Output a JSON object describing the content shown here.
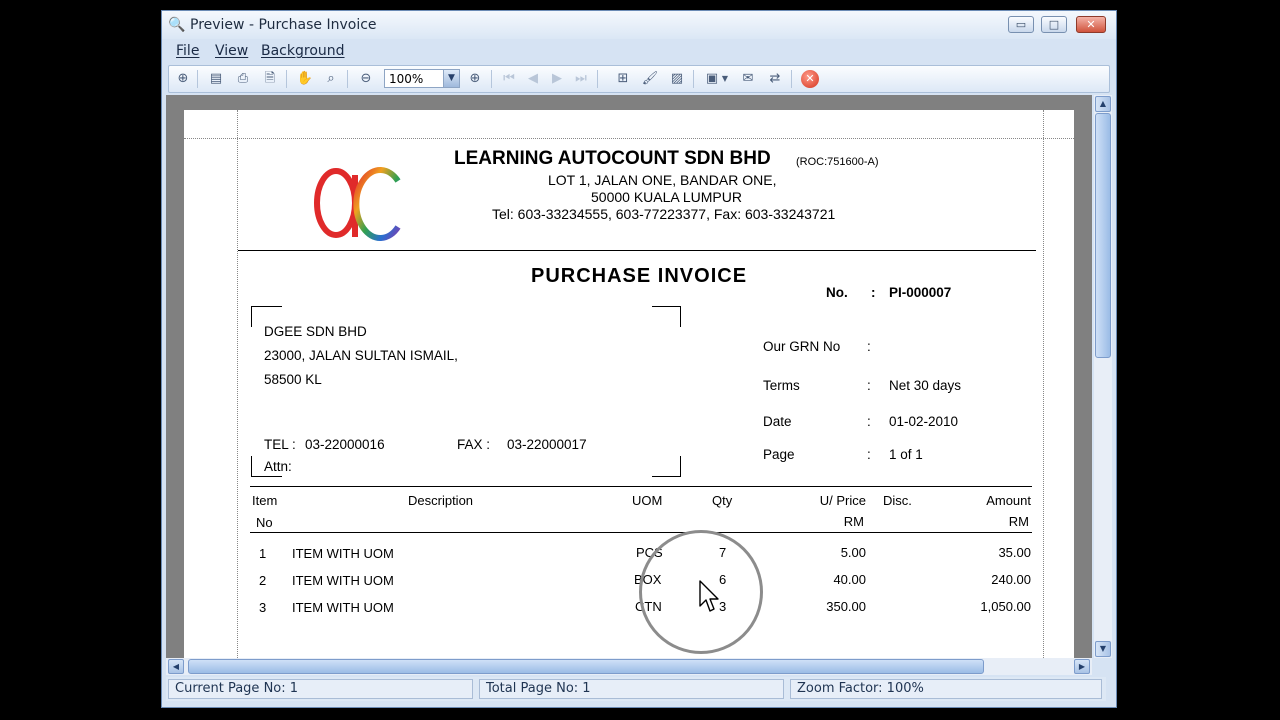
{
  "window": {
    "title": "Preview - Purchase Invoice",
    "minimize_glyph": "▭",
    "maximize_glyph": "□",
    "close_glyph": "✕"
  },
  "menu": [
    "File",
    "View",
    "Background"
  ],
  "toolbar": {
    "zoom_value": "100%",
    "icons": [
      "binoculars-icon",
      "page-setup-icon",
      "print-icon",
      "export-icon",
      "hand-tool-icon",
      "magnifier-icon",
      "zoom-out-icon",
      "zoom-in-icon",
      "first-page-icon",
      "previous-page-icon",
      "next-page-icon",
      "last-page-icon",
      "multiple-pages-icon",
      "page-color-icon",
      "watermark-icon",
      "export-document-icon",
      "email-icon",
      "send-icon",
      "close-preview-icon"
    ]
  },
  "invoice": {
    "company_name": "LEARNING AUTOCOUNT SDN BHD",
    "company_roc": "(ROC:751600-A)",
    "address1": "LOT 1, JALAN ONE,  BANDAR ONE,",
    "address2": "50000 KUALA LUMPUR",
    "contact": "Tel:  603-33234555,  603-77223377,  Fax: 603-33243721",
    "title": "PURCHASE  INVOICE",
    "no_label": "No.",
    "no_value": "PI-000007",
    "supplier": {
      "name": "DGEE SDN BHD",
      "address1": "23000, JALAN SULTAN ISMAIL,",
      "address2": "58500 KL",
      "tel_label": "TEL :",
      "tel_value": "03-22000016",
      "fax_label": "FAX :",
      "fax_value": "03-22000017",
      "attn_label": "Attn:"
    },
    "info": [
      {
        "label": "Our GRN No",
        "sep": ":",
        "value": ""
      },
      {
        "label": "Terms",
        "sep": ":",
        "value": "Net 30 days"
      },
      {
        "label": "Date",
        "sep": ":",
        "value": "01-02-2010"
      },
      {
        "label": "Page",
        "sep": ":",
        "value": "1 of 1"
      }
    ],
    "columns": {
      "item": "Item",
      "item_no": "No",
      "description": "Description",
      "uom": "UOM",
      "qty": "Qty",
      "uprice": "U/ Price",
      "uprice_unit": "RM",
      "disc": "Disc.",
      "amount": "Amount",
      "amount_unit": "RM"
    },
    "rows": [
      {
        "no": "1",
        "desc": "ITEM WITH UOM",
        "uom": "PCS",
        "qty": "7",
        "price": "5.00",
        "amount": "35.00"
      },
      {
        "no": "2",
        "desc": "ITEM WITH UOM",
        "uom": "BOX",
        "qty": "6",
        "price": "40.00",
        "amount": "240.00"
      },
      {
        "no": "3",
        "desc": "ITEM WITH UOM",
        "uom": "CTN",
        "qty": "3",
        "price": "350.00",
        "amount": "1,050.00"
      }
    ]
  },
  "status": {
    "current_page": "Current Page No: 1",
    "total_page": "Total Page No: 1",
    "zoom_factor": "Zoom Factor: 100%"
  }
}
